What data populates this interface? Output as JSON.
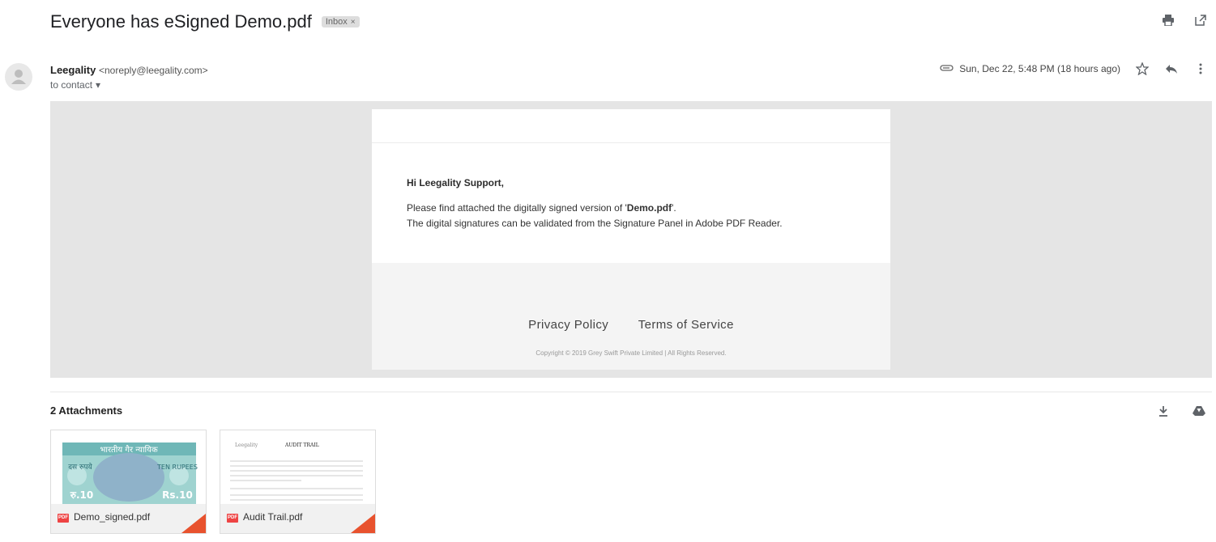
{
  "subject": {
    "title": "Everyone has eSigned Demo.pdf",
    "label": "Inbox",
    "label_close": "×"
  },
  "header_icons": [
    "print-icon",
    "open-in-new-window-icon"
  ],
  "sender": {
    "name": "Leegality",
    "email": "<noreply@leegality.com>",
    "to": "to contact",
    "to_caret": "▾"
  },
  "meta": {
    "date": "Sun, Dec 22, 5:48 PM (18 hours ago)",
    "icons": [
      "attachment-icon",
      "star-icon",
      "reply-icon",
      "more-vert-icon"
    ]
  },
  "body": {
    "greeting": "Hi Leegality Support,",
    "line1_prefix": "Please find attached the digitally signed version of '",
    "line1_file": "Demo.pdf",
    "line1_suffix": "'.",
    "line2": "The digital signatures can be validated from the Signature Panel in Adobe PDF Reader.",
    "footer_links": [
      "Privacy Policy",
      "Terms of Service"
    ],
    "copyright": "Copyright © 2019 Grey Swift Private Limited | All Rights Reserved."
  },
  "attachments": {
    "title": "2 Attachments",
    "icons": [
      "download-all-icon",
      "save-to-drive-icon"
    ],
    "items": [
      {
        "name": "Demo_signed.pdf",
        "badge": "PDF",
        "stamp_text": {
          "top": "भारतीय गैर न्यायिक",
          "left": "दस रुपये",
          "right": "TEN RUPEES",
          "value_left": "रु.10",
          "value_right": "Rs.10"
        }
      },
      {
        "name": "Audit Trail.pdf",
        "badge": "PDF",
        "doc_heading": "AUDIT TRAIL"
      }
    ]
  },
  "colors": {
    "accent_attachment": "#e8522e",
    "pdf_badge": "#ee4444",
    "gray_bg": "#e5e5e5"
  }
}
